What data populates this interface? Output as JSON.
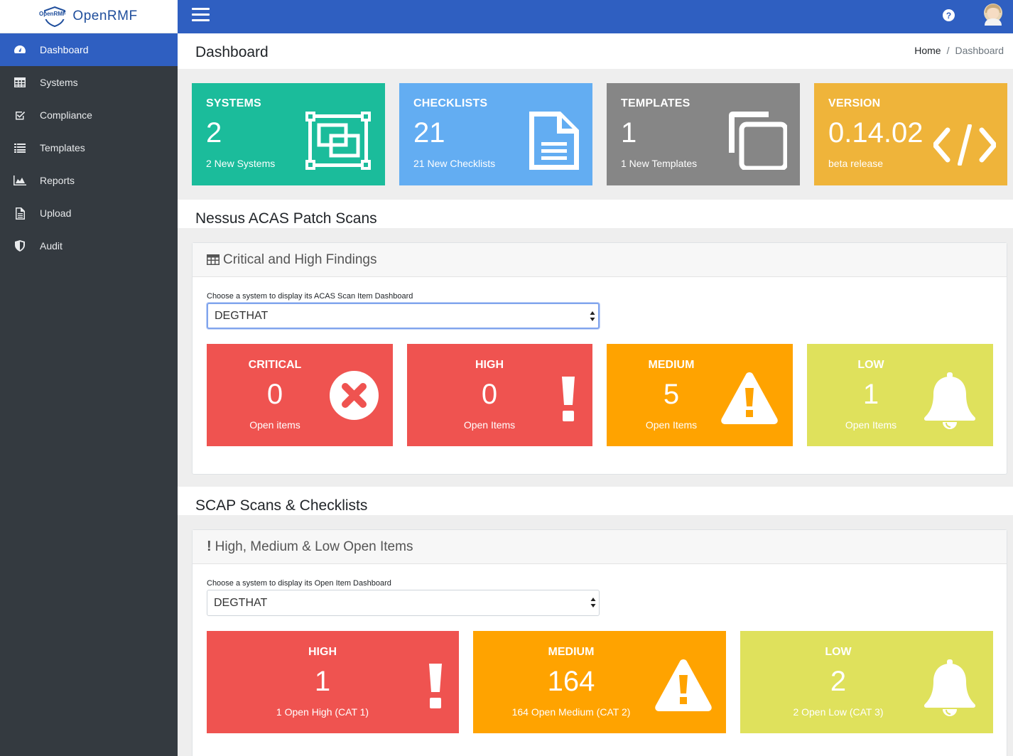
{
  "brand": {
    "logo_badge": "OpenRMF",
    "name": "OpenRMF"
  },
  "sidebar": {
    "items": [
      {
        "label": "Dashboard",
        "icon": "dashboard-gauge-icon",
        "active": true
      },
      {
        "label": "Systems",
        "icon": "table-icon"
      },
      {
        "label": "Compliance",
        "icon": "check-square-icon"
      },
      {
        "label": "Templates",
        "icon": "list-icon"
      },
      {
        "label": "Reports",
        "icon": "area-chart-icon"
      },
      {
        "label": "Upload",
        "icon": "file-icon"
      },
      {
        "label": "Audit",
        "icon": "shield-icon"
      }
    ]
  },
  "topbar": {
    "help": "?",
    "menu_icon": "hamburger-icon",
    "avatar_icon": "user-avatar-icon"
  },
  "header": {
    "title": "Dashboard",
    "breadcrumb": [
      "Home",
      "Dashboard"
    ],
    "separator": "/"
  },
  "info_boxes": [
    {
      "title": "SYSTEMS",
      "number": "2",
      "sub": "2 New Systems",
      "color": "#1bbc9b",
      "icon": "object-group-icon"
    },
    {
      "title": "CHECKLISTS",
      "number": "21",
      "sub": "21 New Checklists",
      "color": "#63adf2",
      "icon": "file-text-icon"
    },
    {
      "title": "TEMPLATES",
      "number": "1",
      "sub": "1 New Templates",
      "color": "#868686",
      "icon": "copy-icon"
    },
    {
      "title": "VERSION",
      "number": "0.14.02",
      "sub": "beta release",
      "color": "#efb43a",
      "icon": "code-icon"
    }
  ],
  "nessus": {
    "section_title": "Nessus ACAS Patch Scans",
    "card_title": "Critical and High Findings",
    "select_label": "Choose a system to display its ACAS Scan Item Dashboard",
    "select_value": "DEGTHAT",
    "boxes": [
      {
        "title": "CRITICAL",
        "number": "0",
        "sub": "Open items",
        "color": "#ef5350",
        "icon": "times-circle-icon"
      },
      {
        "title": "HIGH",
        "number": "0",
        "sub": "Open Items",
        "color": "#ef5350",
        "icon": "exclamation-icon"
      },
      {
        "title": "MEDIUM",
        "number": "5",
        "sub": "Open Items",
        "color": "#ffa300",
        "icon": "warning-triangle-icon"
      },
      {
        "title": "LOW",
        "number": "1",
        "sub": "Open Items",
        "color": "#dfe15c",
        "icon": "bell-icon"
      }
    ]
  },
  "scap": {
    "section_title": "SCAP Scans & Checklists",
    "card_title": "High, Medium & Low Open Items",
    "card_icon": "!",
    "select_label": "Choose a system to display its Open Item Dashboard",
    "select_value": "DEGTHAT",
    "boxes": [
      {
        "title": "HIGH",
        "number": "1",
        "sub": "1 Open High (CAT 1)",
        "color": "#ef5350",
        "icon": "exclamation-icon"
      },
      {
        "title": "MEDIUM",
        "number": "164",
        "sub": "164 Open Medium (CAT 2)",
        "color": "#ffa300",
        "icon": "warning-triangle-icon"
      },
      {
        "title": "LOW",
        "number": "2",
        "sub": "2 Open Low (CAT 3)",
        "color": "#dfe15c",
        "icon": "bell-icon"
      }
    ]
  }
}
